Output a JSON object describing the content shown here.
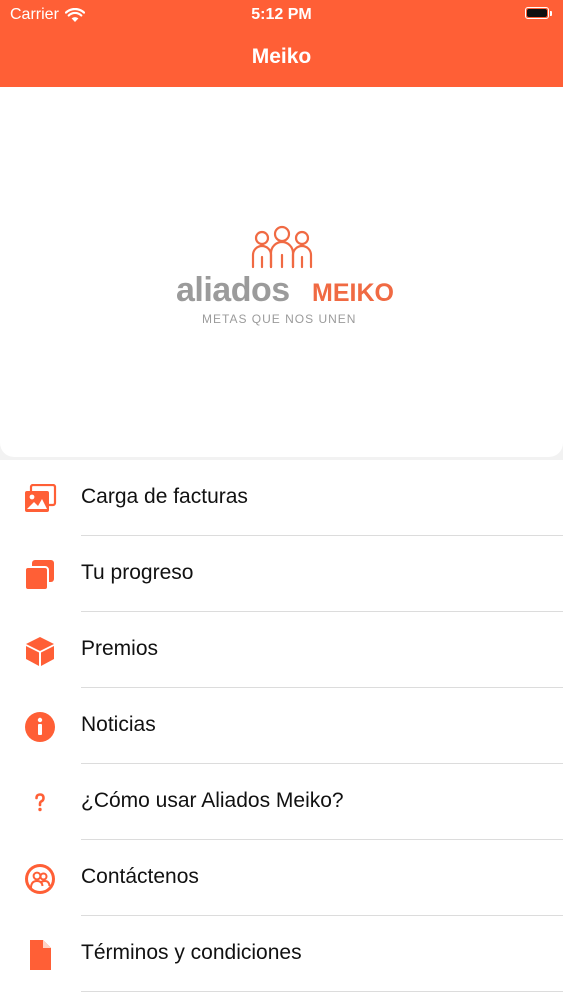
{
  "colors": {
    "brand": "#ff5f36",
    "logo_gray": "#9b9b9b",
    "logo_orange": "#f06a43",
    "text": "#111111",
    "separator": "#dcdcdc"
  },
  "status_bar": {
    "carrier": "Carrier",
    "time": "5:12 PM"
  },
  "nav": {
    "title": "Meiko"
  },
  "logo": {
    "brand_word": "aliados",
    "brand_accent": "MEIKO",
    "tagline": "METAS QUE NOS UNEN"
  },
  "menu": {
    "items": [
      {
        "label": "Carga de facturas",
        "icon": "images-icon"
      },
      {
        "label": "Tu progreso",
        "icon": "copy-icon"
      },
      {
        "label": "Premios",
        "icon": "box-icon"
      },
      {
        "label": "Noticias",
        "icon": "info-icon"
      },
      {
        "label": "¿Cómo usar Aliados Meiko?",
        "icon": "question-icon"
      },
      {
        "label": "Contáctenos",
        "icon": "contact-icon"
      },
      {
        "label": "Términos y condiciones",
        "icon": "document-icon"
      }
    ]
  }
}
